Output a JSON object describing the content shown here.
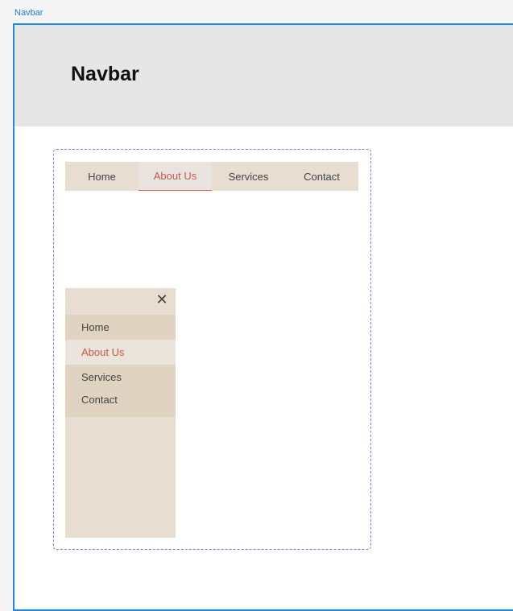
{
  "frame_label": "Navbar",
  "header": {
    "title": "Navbar"
  },
  "nav_horizontal": {
    "items": [
      {
        "label": "Home"
      },
      {
        "label": "About Us"
      },
      {
        "label": "Services"
      },
      {
        "label": "Contact"
      }
    ],
    "active_index": 1
  },
  "nav_vertical": {
    "close_icon": "close-icon",
    "items": [
      {
        "label": "Home"
      },
      {
        "label": "About Us"
      },
      {
        "label": "Services"
      },
      {
        "label": "Contact"
      }
    ],
    "active_index": 1
  },
  "colors": {
    "frame_border": "#1e88e5",
    "header_bg": "#e6e6e6",
    "nav_bg": "#e7ddd0",
    "active_text": "#c8594a",
    "component_border": "#a16de6"
  }
}
